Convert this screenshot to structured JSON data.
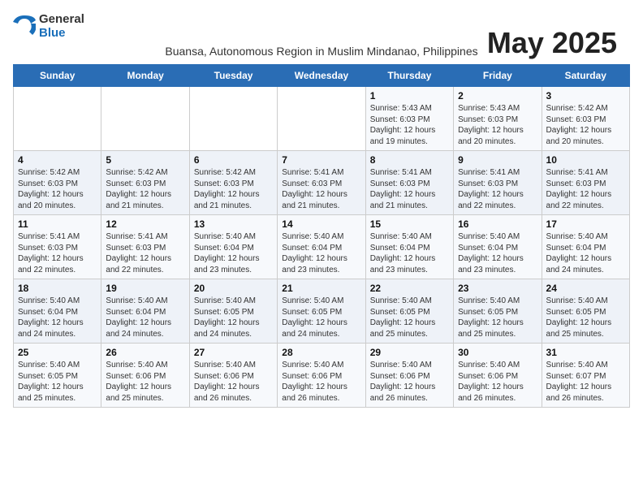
{
  "logo": {
    "general": "General",
    "blue": "Blue"
  },
  "title": "May 2025",
  "subtitle": "Buansa, Autonomous Region in Muslim Mindanao, Philippines",
  "days_of_week": [
    "Sunday",
    "Monday",
    "Tuesday",
    "Wednesday",
    "Thursday",
    "Friday",
    "Saturday"
  ],
  "weeks": [
    [
      {
        "day": "",
        "detail": ""
      },
      {
        "day": "",
        "detail": ""
      },
      {
        "day": "",
        "detail": ""
      },
      {
        "day": "",
        "detail": ""
      },
      {
        "day": "1",
        "detail": "Sunrise: 5:43 AM\nSunset: 6:03 PM\nDaylight: 12 hours and 19 minutes."
      },
      {
        "day": "2",
        "detail": "Sunrise: 5:43 AM\nSunset: 6:03 PM\nDaylight: 12 hours and 20 minutes."
      },
      {
        "day": "3",
        "detail": "Sunrise: 5:42 AM\nSunset: 6:03 PM\nDaylight: 12 hours and 20 minutes."
      }
    ],
    [
      {
        "day": "4",
        "detail": "Sunrise: 5:42 AM\nSunset: 6:03 PM\nDaylight: 12 hours and 20 minutes."
      },
      {
        "day": "5",
        "detail": "Sunrise: 5:42 AM\nSunset: 6:03 PM\nDaylight: 12 hours and 21 minutes."
      },
      {
        "day": "6",
        "detail": "Sunrise: 5:42 AM\nSunset: 6:03 PM\nDaylight: 12 hours and 21 minutes."
      },
      {
        "day": "7",
        "detail": "Sunrise: 5:41 AM\nSunset: 6:03 PM\nDaylight: 12 hours and 21 minutes."
      },
      {
        "day": "8",
        "detail": "Sunrise: 5:41 AM\nSunset: 6:03 PM\nDaylight: 12 hours and 21 minutes."
      },
      {
        "day": "9",
        "detail": "Sunrise: 5:41 AM\nSunset: 6:03 PM\nDaylight: 12 hours and 22 minutes."
      },
      {
        "day": "10",
        "detail": "Sunrise: 5:41 AM\nSunset: 6:03 PM\nDaylight: 12 hours and 22 minutes."
      }
    ],
    [
      {
        "day": "11",
        "detail": "Sunrise: 5:41 AM\nSunset: 6:03 PM\nDaylight: 12 hours and 22 minutes."
      },
      {
        "day": "12",
        "detail": "Sunrise: 5:41 AM\nSunset: 6:03 PM\nDaylight: 12 hours and 22 minutes."
      },
      {
        "day": "13",
        "detail": "Sunrise: 5:40 AM\nSunset: 6:04 PM\nDaylight: 12 hours and 23 minutes."
      },
      {
        "day": "14",
        "detail": "Sunrise: 5:40 AM\nSunset: 6:04 PM\nDaylight: 12 hours and 23 minutes."
      },
      {
        "day": "15",
        "detail": "Sunrise: 5:40 AM\nSunset: 6:04 PM\nDaylight: 12 hours and 23 minutes."
      },
      {
        "day": "16",
        "detail": "Sunrise: 5:40 AM\nSunset: 6:04 PM\nDaylight: 12 hours and 23 minutes."
      },
      {
        "day": "17",
        "detail": "Sunrise: 5:40 AM\nSunset: 6:04 PM\nDaylight: 12 hours and 24 minutes."
      }
    ],
    [
      {
        "day": "18",
        "detail": "Sunrise: 5:40 AM\nSunset: 6:04 PM\nDaylight: 12 hours and 24 minutes."
      },
      {
        "day": "19",
        "detail": "Sunrise: 5:40 AM\nSunset: 6:04 PM\nDaylight: 12 hours and 24 minutes."
      },
      {
        "day": "20",
        "detail": "Sunrise: 5:40 AM\nSunset: 6:05 PM\nDaylight: 12 hours and 24 minutes."
      },
      {
        "day": "21",
        "detail": "Sunrise: 5:40 AM\nSunset: 6:05 PM\nDaylight: 12 hours and 24 minutes."
      },
      {
        "day": "22",
        "detail": "Sunrise: 5:40 AM\nSunset: 6:05 PM\nDaylight: 12 hours and 25 minutes."
      },
      {
        "day": "23",
        "detail": "Sunrise: 5:40 AM\nSunset: 6:05 PM\nDaylight: 12 hours and 25 minutes."
      },
      {
        "day": "24",
        "detail": "Sunrise: 5:40 AM\nSunset: 6:05 PM\nDaylight: 12 hours and 25 minutes."
      }
    ],
    [
      {
        "day": "25",
        "detail": "Sunrise: 5:40 AM\nSunset: 6:05 PM\nDaylight: 12 hours and 25 minutes."
      },
      {
        "day": "26",
        "detail": "Sunrise: 5:40 AM\nSunset: 6:06 PM\nDaylight: 12 hours and 25 minutes."
      },
      {
        "day": "27",
        "detail": "Sunrise: 5:40 AM\nSunset: 6:06 PM\nDaylight: 12 hours and 26 minutes."
      },
      {
        "day": "28",
        "detail": "Sunrise: 5:40 AM\nSunset: 6:06 PM\nDaylight: 12 hours and 26 minutes."
      },
      {
        "day": "29",
        "detail": "Sunrise: 5:40 AM\nSunset: 6:06 PM\nDaylight: 12 hours and 26 minutes."
      },
      {
        "day": "30",
        "detail": "Sunrise: 5:40 AM\nSunset: 6:06 PM\nDaylight: 12 hours and 26 minutes."
      },
      {
        "day": "31",
        "detail": "Sunrise: 5:40 AM\nSunset: 6:07 PM\nDaylight: 12 hours and 26 minutes."
      }
    ]
  ]
}
